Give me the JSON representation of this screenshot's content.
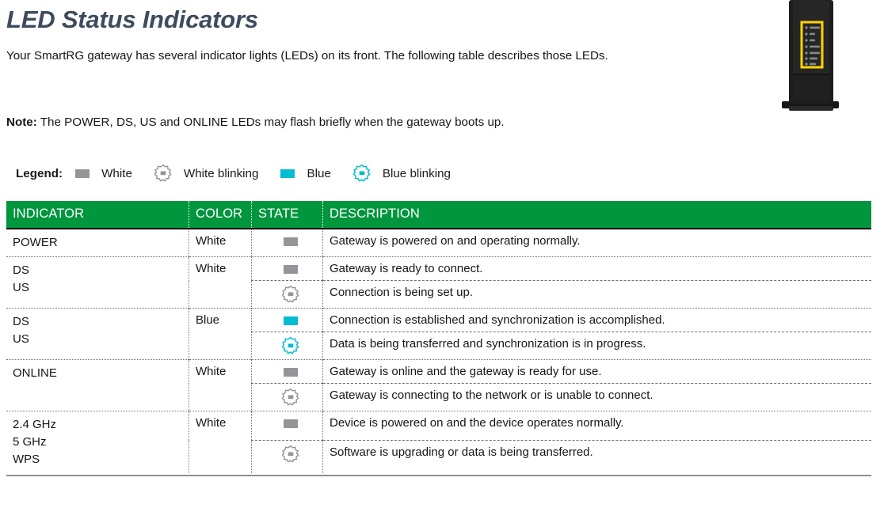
{
  "page": {
    "title": "LED Status Indicators",
    "intro": "Your SmartRG gateway has several indicator lights (LEDs) on its front. The following table describes those LEDs.",
    "note_label": "Note:",
    "note_text": " The POWER, DS, US and ONLINE LEDs may flash briefly when the gateway boots up."
  },
  "colors": {
    "header_green": "#00963e",
    "title_slate": "#3d4b5c",
    "led_white_gray": "#939598",
    "led_blue_cyan": "#00bcd4",
    "router_black": "#1d1d1b",
    "highlight_yellow": "#ffd400"
  },
  "legend": {
    "label": "Legend:",
    "items": [
      {
        "icon": "led-white-solid-icon",
        "label": "White"
      },
      {
        "icon": "led-white-blinking-icon",
        "label": "White blinking"
      },
      {
        "icon": "led-blue-solid-icon",
        "label": "Blue"
      },
      {
        "icon": "led-blue-blinking-icon",
        "label": "Blue blinking"
      }
    ]
  },
  "table": {
    "headers": {
      "indicator": "INDICATOR",
      "color": "COLOR",
      "state": "STATE",
      "description": "DESCRIPTION"
    },
    "groups": [
      {
        "indicator_lines": [
          "POWER"
        ],
        "color": "White",
        "rows": [
          {
            "state_icon": "led-white-solid-icon",
            "description": "Gateway is powered on and operating normally."
          }
        ]
      },
      {
        "indicator_lines": [
          "DS",
          "US"
        ],
        "color": "White",
        "rows": [
          {
            "state_icon": "led-white-solid-icon",
            "description": "Gateway is ready to connect."
          },
          {
            "state_icon": "led-white-blinking-icon",
            "description": "Connection is being set up."
          }
        ]
      },
      {
        "indicator_lines": [
          "DS",
          "US"
        ],
        "color": "Blue",
        "rows": [
          {
            "state_icon": "led-blue-solid-icon",
            "description": "Connection is established and synchronization is accomplished."
          },
          {
            "state_icon": "led-blue-blinking-icon",
            "description": "Data is being transferred and synchronization is in progress."
          }
        ]
      },
      {
        "indicator_lines": [
          "ONLINE"
        ],
        "color": "White",
        "rows": [
          {
            "state_icon": "led-white-solid-icon",
            "description": "Gateway is online and the gateway is ready for use."
          },
          {
            "state_icon": "led-white-blinking-icon",
            "description": "Gateway is connecting to the network or is unable to connect."
          }
        ]
      },
      {
        "indicator_lines": [
          "2.4 GHz",
          "5 GHz",
          "WPS"
        ],
        "color": "White",
        "rows": [
          {
            "state_icon": "led-white-solid-icon",
            "description": "Device is powered on and the device operates normally."
          },
          {
            "state_icon": "led-white-blinking-icon",
            "description": "Software is upgrading or data is being transferred."
          }
        ]
      }
    ]
  },
  "illustration": {
    "name": "smartrg-gateway-photo",
    "led_panel_labels": [
      "POWER",
      "DS",
      "US",
      "ONLINE",
      "2.4 GHz",
      "5 GHz",
      "WPS"
    ]
  }
}
